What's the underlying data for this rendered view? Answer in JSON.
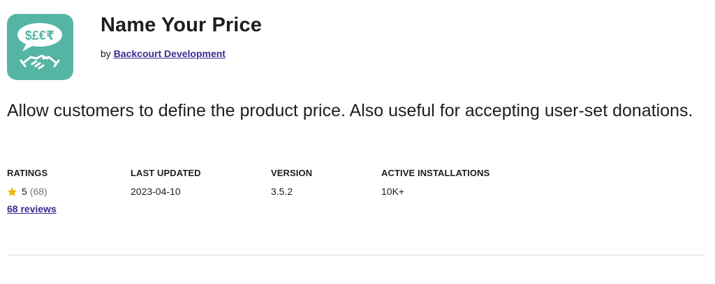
{
  "plugin": {
    "name": "Name Your Price",
    "by_prefix": "by",
    "author": "Backcourt Development",
    "description": "Allow customers to define the product price. Also useful for accepting user-set donations.",
    "icon": {
      "name": "price-handshake-icon",
      "bubble_text": "$£€₹",
      "background_color": "#55b5a5"
    }
  },
  "meta": {
    "ratings": {
      "label": "RATINGS",
      "score": "5",
      "count": "(68)",
      "reviews_link": "68 reviews",
      "star_icon": "star-icon",
      "star_color": "#f0b400"
    },
    "last_updated": {
      "label": "LAST UPDATED",
      "value": "2023-04-10"
    },
    "version": {
      "label": "VERSION",
      "value": "3.5.2"
    },
    "active_installations": {
      "label": "ACTIVE INSTALLATIONS",
      "value": "10K+"
    }
  },
  "colors": {
    "link": "#3b2a8f",
    "text": "#1e1e1e",
    "muted": "#757575",
    "divider": "#dcdcde"
  }
}
